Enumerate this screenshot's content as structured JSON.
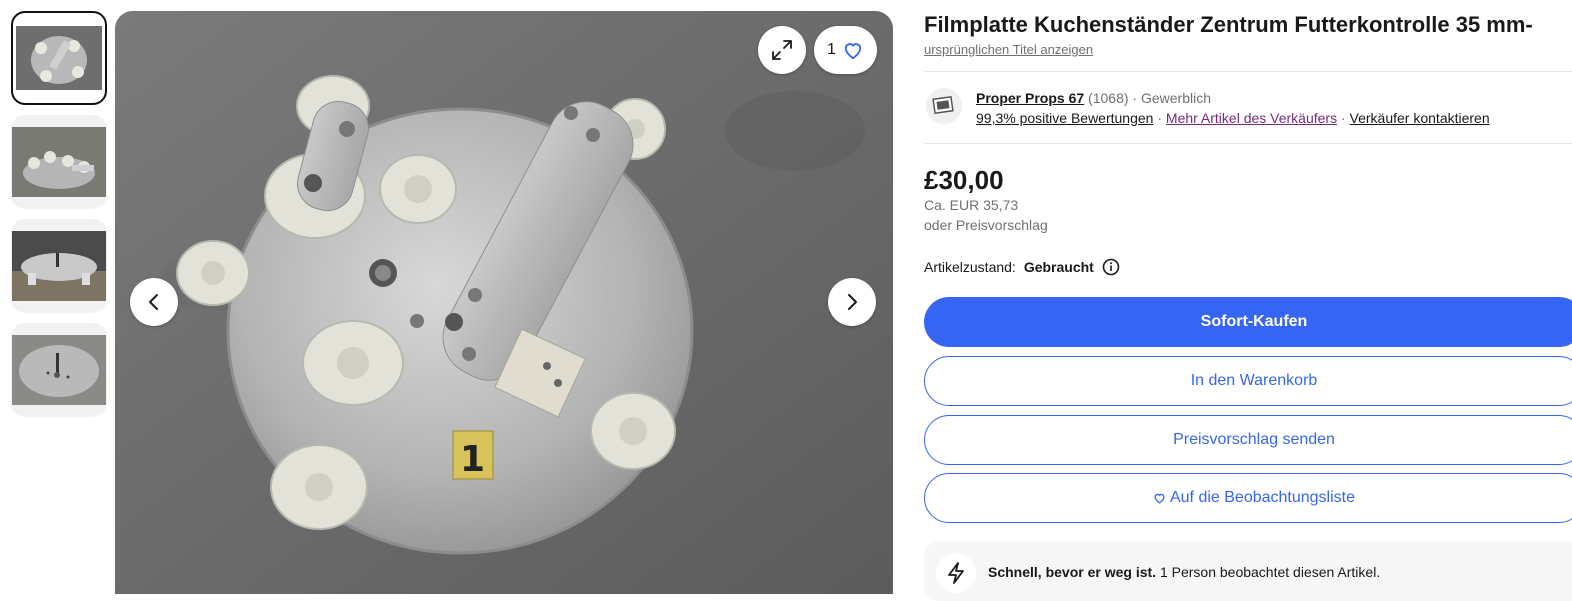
{
  "gallery": {
    "thumbnails": [
      {
        "label": "thumbnail-1"
      },
      {
        "label": "thumbnail-2"
      },
      {
        "label": "thumbnail-3"
      },
      {
        "label": "thumbnail-4"
      }
    ],
    "like_count": "1",
    "photo_tag": "1"
  },
  "listing": {
    "title": "Filmplatte Kuchenständer Zentrum Futterkontrolle 35 mm-",
    "original_title_link": "ursprünglichen Titel anzeigen"
  },
  "seller": {
    "name": "Proper Props 67",
    "count": "(1068)",
    "sep": "·",
    "type": "Gewerblich",
    "feedback": "99,3% positive Bewertungen",
    "more_items": "Mehr Artikel des Verkäufers",
    "contact": "Verkäufer kontaktieren"
  },
  "pricing": {
    "price": "£30,00",
    "approx": "Ca. EUR 35,73",
    "offer_note": "oder Preisvorschlag"
  },
  "condition": {
    "label": "Artikelzustand:",
    "value": "Gebraucht"
  },
  "actions": {
    "buy_now": "Sofort-Kaufen",
    "add_to_cart": "In den Warenkorb",
    "make_offer": "Preisvorschlag senden",
    "watchlist": "Auf die Beobachtungsliste"
  },
  "urgency": {
    "bold": "Schnell, bevor er weg ist.",
    "text": " 1 Person beobachtet diesen Artikel."
  },
  "colors": {
    "accent": "#3665f3",
    "link_purple": "#7a2a7a",
    "muted_text": "#707070"
  }
}
